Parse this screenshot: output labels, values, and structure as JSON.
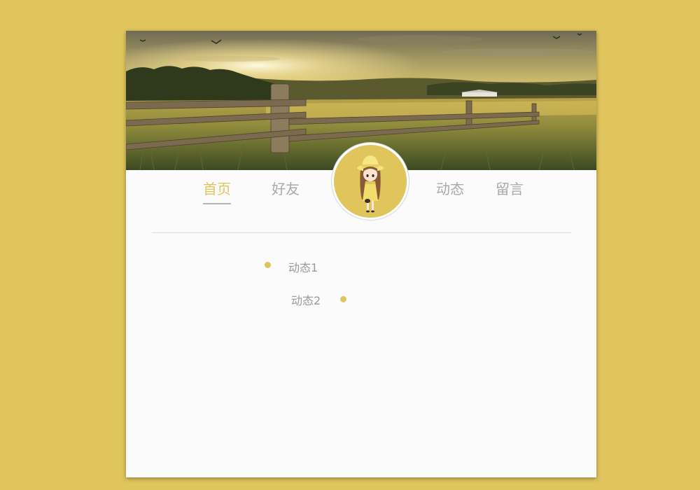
{
  "nav": {
    "items": [
      {
        "label": "首页",
        "active": true
      },
      {
        "label": "好友",
        "active": false
      },
      {
        "label": "动态",
        "active": false
      },
      {
        "label": "留言",
        "active": false
      }
    ]
  },
  "avatar": {
    "icon": "girl-avatar-icon"
  },
  "feed": {
    "items": [
      {
        "label": "动态1"
      },
      {
        "label": "动态2"
      }
    ]
  },
  "colors": {
    "background": "#e0c55d",
    "accent": "#e0c55d",
    "card": "#fbfbfb",
    "text_muted": "#a9a9a9"
  }
}
